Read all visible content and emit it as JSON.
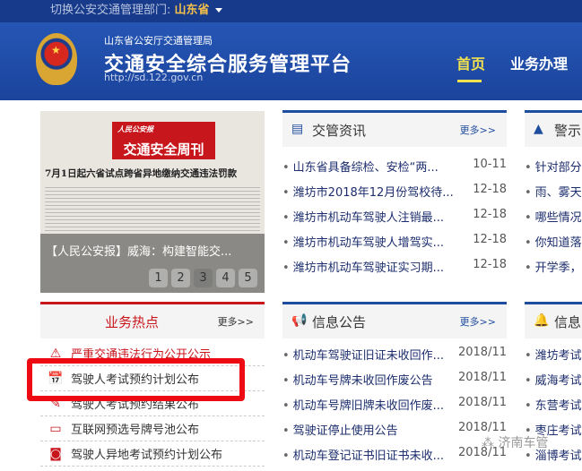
{
  "topbar": {
    "label": "切换公安交通管理部门:",
    "province": "山东省"
  },
  "header": {
    "subtitle": "山东省公安厅交通管理局",
    "title": "交通安全综合服务管理平台",
    "url": "http://sd.122.gov.cn",
    "nav": [
      "首页",
      "业务办理"
    ]
  },
  "carousel": {
    "paper_brand": "人民公安报",
    "paper_title": "交通安全周刊",
    "headline": "7月1日起六省试点跨省异地缴纳交通违法罚款",
    "caption": "【人民公安报】威海：构建智能交...",
    "pages": [
      "1",
      "2",
      "3",
      "4",
      "5"
    ]
  },
  "hot": {
    "title": "业务热点",
    "more": "更多>>",
    "items": [
      "严重交通违法行为公开公示",
      "驾驶人考试预约计划公布",
      "驾驶人考试预约结果公布",
      "互联网预选号牌号池公布",
      "驾驶人异地考试预约计划公布"
    ]
  },
  "news": {
    "title": "交管资讯",
    "more": "更多>>",
    "items": [
      {
        "t": "山东省具备综检、安检“两...",
        "d": "10-11"
      },
      {
        "t": "潍坊市2018年12月份驾校待...",
        "d": "12-18"
      },
      {
        "t": "潍坊市机动车驾驶人注销最...",
        "d": "12-18"
      },
      {
        "t": "潍坊市机动车驾驶人增驾实...",
        "d": "12-18"
      },
      {
        "t": "潍坊市机动车驾驶证实习期...",
        "d": "12-18"
      }
    ]
  },
  "notice": {
    "title": "信息公告",
    "more": "更多>>",
    "items": [
      {
        "t": "机动车驾驶证旧证未收回作...",
        "d": "2018/11"
      },
      {
        "t": "机动车号牌未收回作废公告",
        "d": "2018/11"
      },
      {
        "t": "机动车号牌旧牌未收回作废...",
        "d": "2018/11"
      },
      {
        "t": "驾驶证停止使用公告",
        "d": "2018/11"
      },
      {
        "t": "机动车登记证书旧证书未收...",
        "d": "2018/11"
      }
    ]
  },
  "warn": {
    "title": "警示",
    "items": [
      "针对部分",
      "雨、雾天",
      "哪些情况",
      "你知道落",
      "开学季，"
    ]
  },
  "info": {
    "title": "信息",
    "items": [
      "潍坊考试",
      "威海考试",
      "东营考试",
      "枣庄考试",
      "淄博考试"
    ]
  },
  "watermark": "济南车管"
}
